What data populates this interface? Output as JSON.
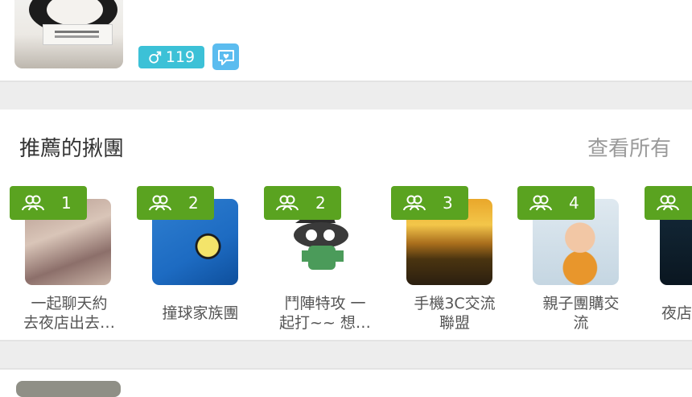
{
  "profile": {
    "gender_icon": "male-icon",
    "age": "119",
    "chat_icon": "chat-heart-icon",
    "badge_color": "#3cc1d7",
    "chat_color": "#5bbcef"
  },
  "recommended": {
    "title": "推薦的揪團",
    "see_all": "查看所有",
    "accent": "#5aa320",
    "groups": [
      {
        "count": "1",
        "name_line1": "一起聊天約",
        "name_line2": "去夜店出去…",
        "icon": "people-icon"
      },
      {
        "count": "2",
        "name_line1": "撞球家族團",
        "name_line2": "",
        "icon": "people-icon"
      },
      {
        "count": "2",
        "name_line1": "鬥陣特攻 一",
        "name_line2": "起打~~ 想…",
        "icon": "people-icon"
      },
      {
        "count": "3",
        "name_line1": "手機3C交流",
        "name_line2": "聯盟",
        "icon": "people-icon"
      },
      {
        "count": "4",
        "name_line1": "親子團購交",
        "name_line2": "流",
        "icon": "people-icon"
      },
      {
        "count": "",
        "name_line1": "夜店",
        "name_line2": "",
        "icon": "people-icon"
      }
    ]
  }
}
